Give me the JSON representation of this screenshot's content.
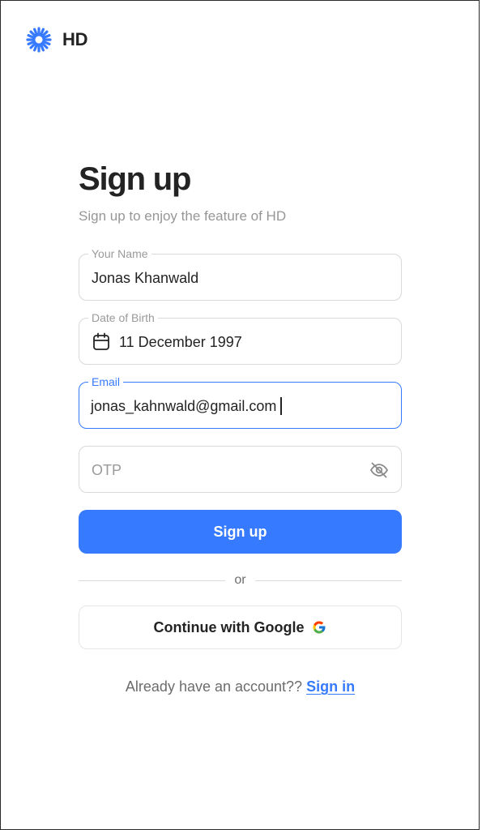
{
  "brand": {
    "name": "HD",
    "accent": "#367AFF"
  },
  "header": {
    "title": "Sign up",
    "subtitle": "Sign up to enjoy the feature of HD"
  },
  "form": {
    "name": {
      "label": "Your Name",
      "value": "Jonas Khanwald"
    },
    "dob": {
      "label": "Date of Birth",
      "value": "11 December 1997",
      "icon": "calendar-icon"
    },
    "email": {
      "label": "Email",
      "value": "jonas_kahnwald@gmail.com"
    },
    "otp": {
      "placeholder": "OTP",
      "icon": "eye-off-icon"
    }
  },
  "actions": {
    "signup_label": "Sign up",
    "divider_text": "or",
    "google_label": "Continue with Google"
  },
  "footer": {
    "prompt": "Already have an account??",
    "link": "Sign in"
  }
}
